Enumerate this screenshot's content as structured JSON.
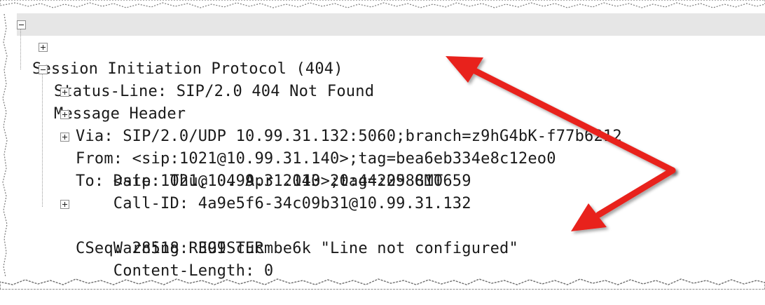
{
  "colors": {
    "row_highlight": "#e6e6e6",
    "arrow": "#e8231f",
    "text": "#1a1a1a"
  },
  "icons": {
    "expanded": "minus-box-icon",
    "collapsed": "plus-box-icon"
  },
  "tree": {
    "root": {
      "label": "Session Initiation Protocol (404)",
      "expanded": true
    },
    "status_line": {
      "label": "Status-Line: SIP/2.0 404 Not Found",
      "expanded": false
    },
    "message_header": {
      "label": "Message Header",
      "expanded": true,
      "fields": [
        {
          "label": "Via: SIP/2.0/UDP 10.99.31.132:5060;branch=z9hG4bK-f77b6212",
          "expandable": true
        },
        {
          "label": "From: <sip:1021@10.99.31.140>;tag=bea6eb334e8c12eo0",
          "expandable": true
        },
        {
          "label": "To: <sip:1021@10.99.31.140>;tag=2098810659",
          "expandable": true
        },
        {
          "label": "Date: Thu, 04 Apr 2013 20:44:25 GMT",
          "expandable": false
        },
        {
          "label": "Call-ID: 4a9e5f6-34c09b31@10.99.31.132",
          "expandable": false
        },
        {
          "label": "CSeq: 28518 REGISTER",
          "expandable": true
        },
        {
          "label": "Warning: 399 cucmbe6k \"Line not configured\"",
          "expandable": false
        },
        {
          "label": "Content-Length: 0",
          "expandable": false
        }
      ]
    }
  }
}
